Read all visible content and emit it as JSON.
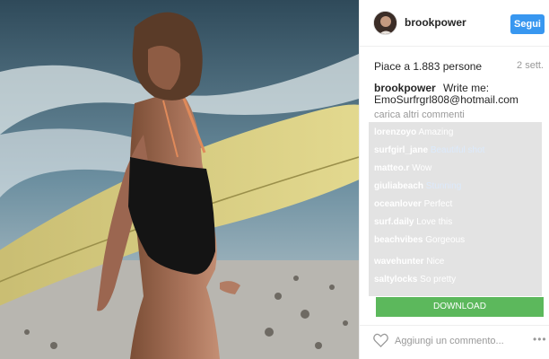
{
  "post": {
    "image_alt": "Woman in black swimsuit holding yellow surfboard on beach",
    "username": "brookpower",
    "follow_label": "Segui",
    "likes": "Piace a 1.883 persone",
    "time": "2 sett.",
    "caption_user": "brookpower",
    "caption_text": "Write me:",
    "caption_email": "EmoSurfrgrl808@hotmail.com",
    "load_more": "carica altri commenti",
    "comments": [
      {
        "user": "lorenzoyo",
        "text": "Amazing"
      },
      {
        "user": "surfgirl_jane",
        "text": "Beautiful shot"
      },
      {
        "user": "matteo.r",
        "text": "Wow"
      },
      {
        "user": "giuliabeach",
        "text": "Stunning"
      },
      {
        "user": "oceanlover",
        "text": "Perfect"
      },
      {
        "user": "surf.daily",
        "text": "Love this"
      },
      {
        "user": "beachvibes",
        "text": "Gorgeous"
      },
      {
        "user": "wavehunter",
        "text": "Nice"
      },
      {
        "user": "saltylocks",
        "text": "So pretty"
      }
    ],
    "download_label": "DOWNLOAD",
    "add_comment_placeholder": "Aggiungi un commento...",
    "more_label": "•••"
  }
}
